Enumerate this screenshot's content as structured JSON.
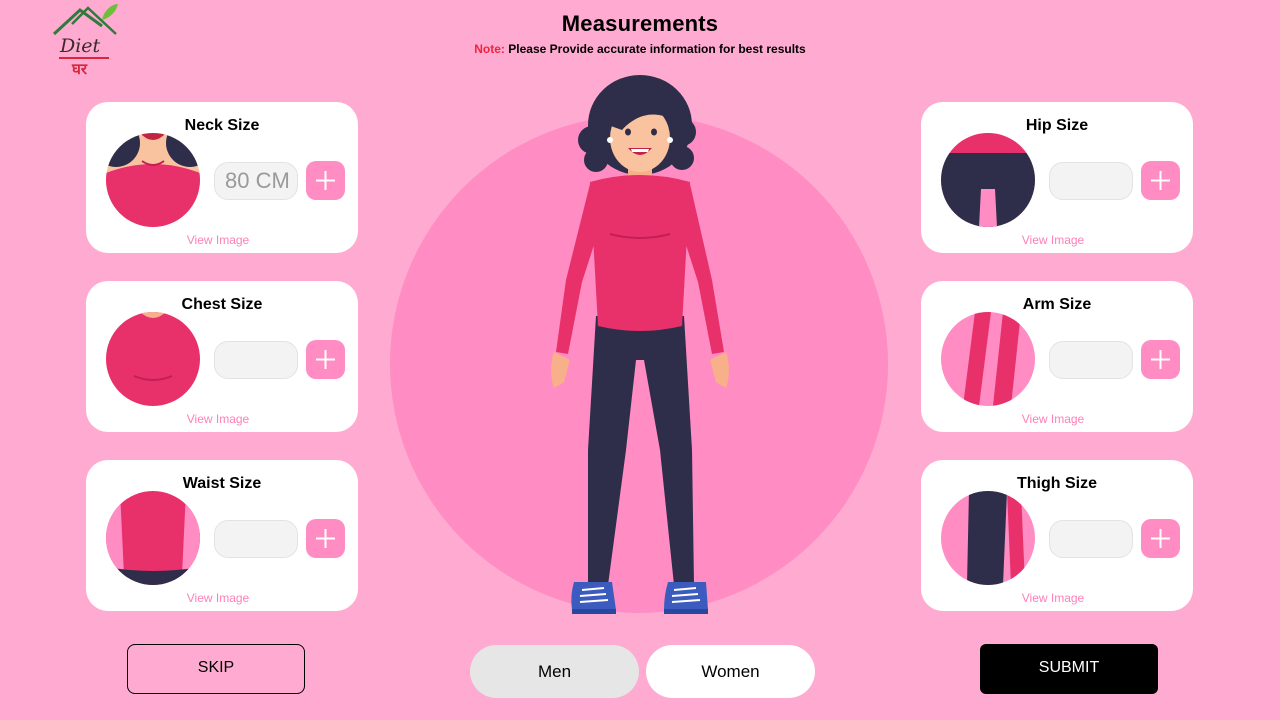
{
  "header": {
    "title": "Measurements",
    "note_label": "Note:",
    "note_text": "Please Provide accurate information for best results"
  },
  "logo": {
    "text_top": "Diet",
    "text_bottom": "घर"
  },
  "cards": {
    "neck": {
      "title": "Neck Size",
      "value": "80 CM",
      "placeholder": "",
      "view": "View Image"
    },
    "chest": {
      "title": "Chest Size",
      "value": "",
      "placeholder": "",
      "view": "View Image"
    },
    "waist": {
      "title": "Waist Size",
      "value": "",
      "placeholder": "",
      "view": "View Image"
    },
    "hip": {
      "title": "Hip Size",
      "value": "",
      "placeholder": "",
      "view": "View Image"
    },
    "arm": {
      "title": "Arm Size",
      "value": "",
      "placeholder": "",
      "view": "View Image"
    },
    "thigh": {
      "title": "Thigh Size",
      "value": "",
      "placeholder": "",
      "view": "View Image"
    }
  },
  "footer": {
    "skip": "SKIP",
    "submit": "SUBMIT",
    "gender_options": [
      "Men",
      "Women"
    ],
    "selected_gender": "Men"
  },
  "icons": {
    "add": "plus-icon"
  },
  "colors": {
    "background": "#ffaad0",
    "accent": "#ff8cc2",
    "shirt": "#e8306a",
    "pants": "#2e2d4a",
    "note": "#f0243f",
    "link": "#ff80b9"
  }
}
